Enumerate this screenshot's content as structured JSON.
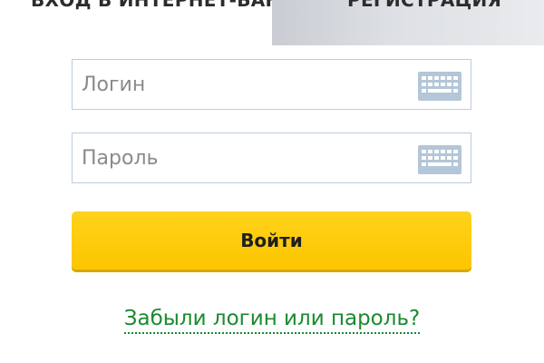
{
  "tabs": {
    "login_label": "ВХОД В ИНТЕРНЕТ-БАНК",
    "register_label": "РЕГИСТРАЦИЯ"
  },
  "form": {
    "login": {
      "placeholder": "Логин",
      "value": ""
    },
    "password": {
      "placeholder": "Пароль",
      "value": ""
    },
    "submit_label": "Войти",
    "forgot_label": "Забыли логин или пароль?"
  },
  "icons": {
    "keyboard": "keyboard-icon"
  },
  "colors": {
    "button": "#fcc600",
    "link": "#1a8a2e",
    "field_border": "#b9cde0",
    "keyboard_icon": "#b4c6d8",
    "tab_inactive": "#dde0e4"
  }
}
